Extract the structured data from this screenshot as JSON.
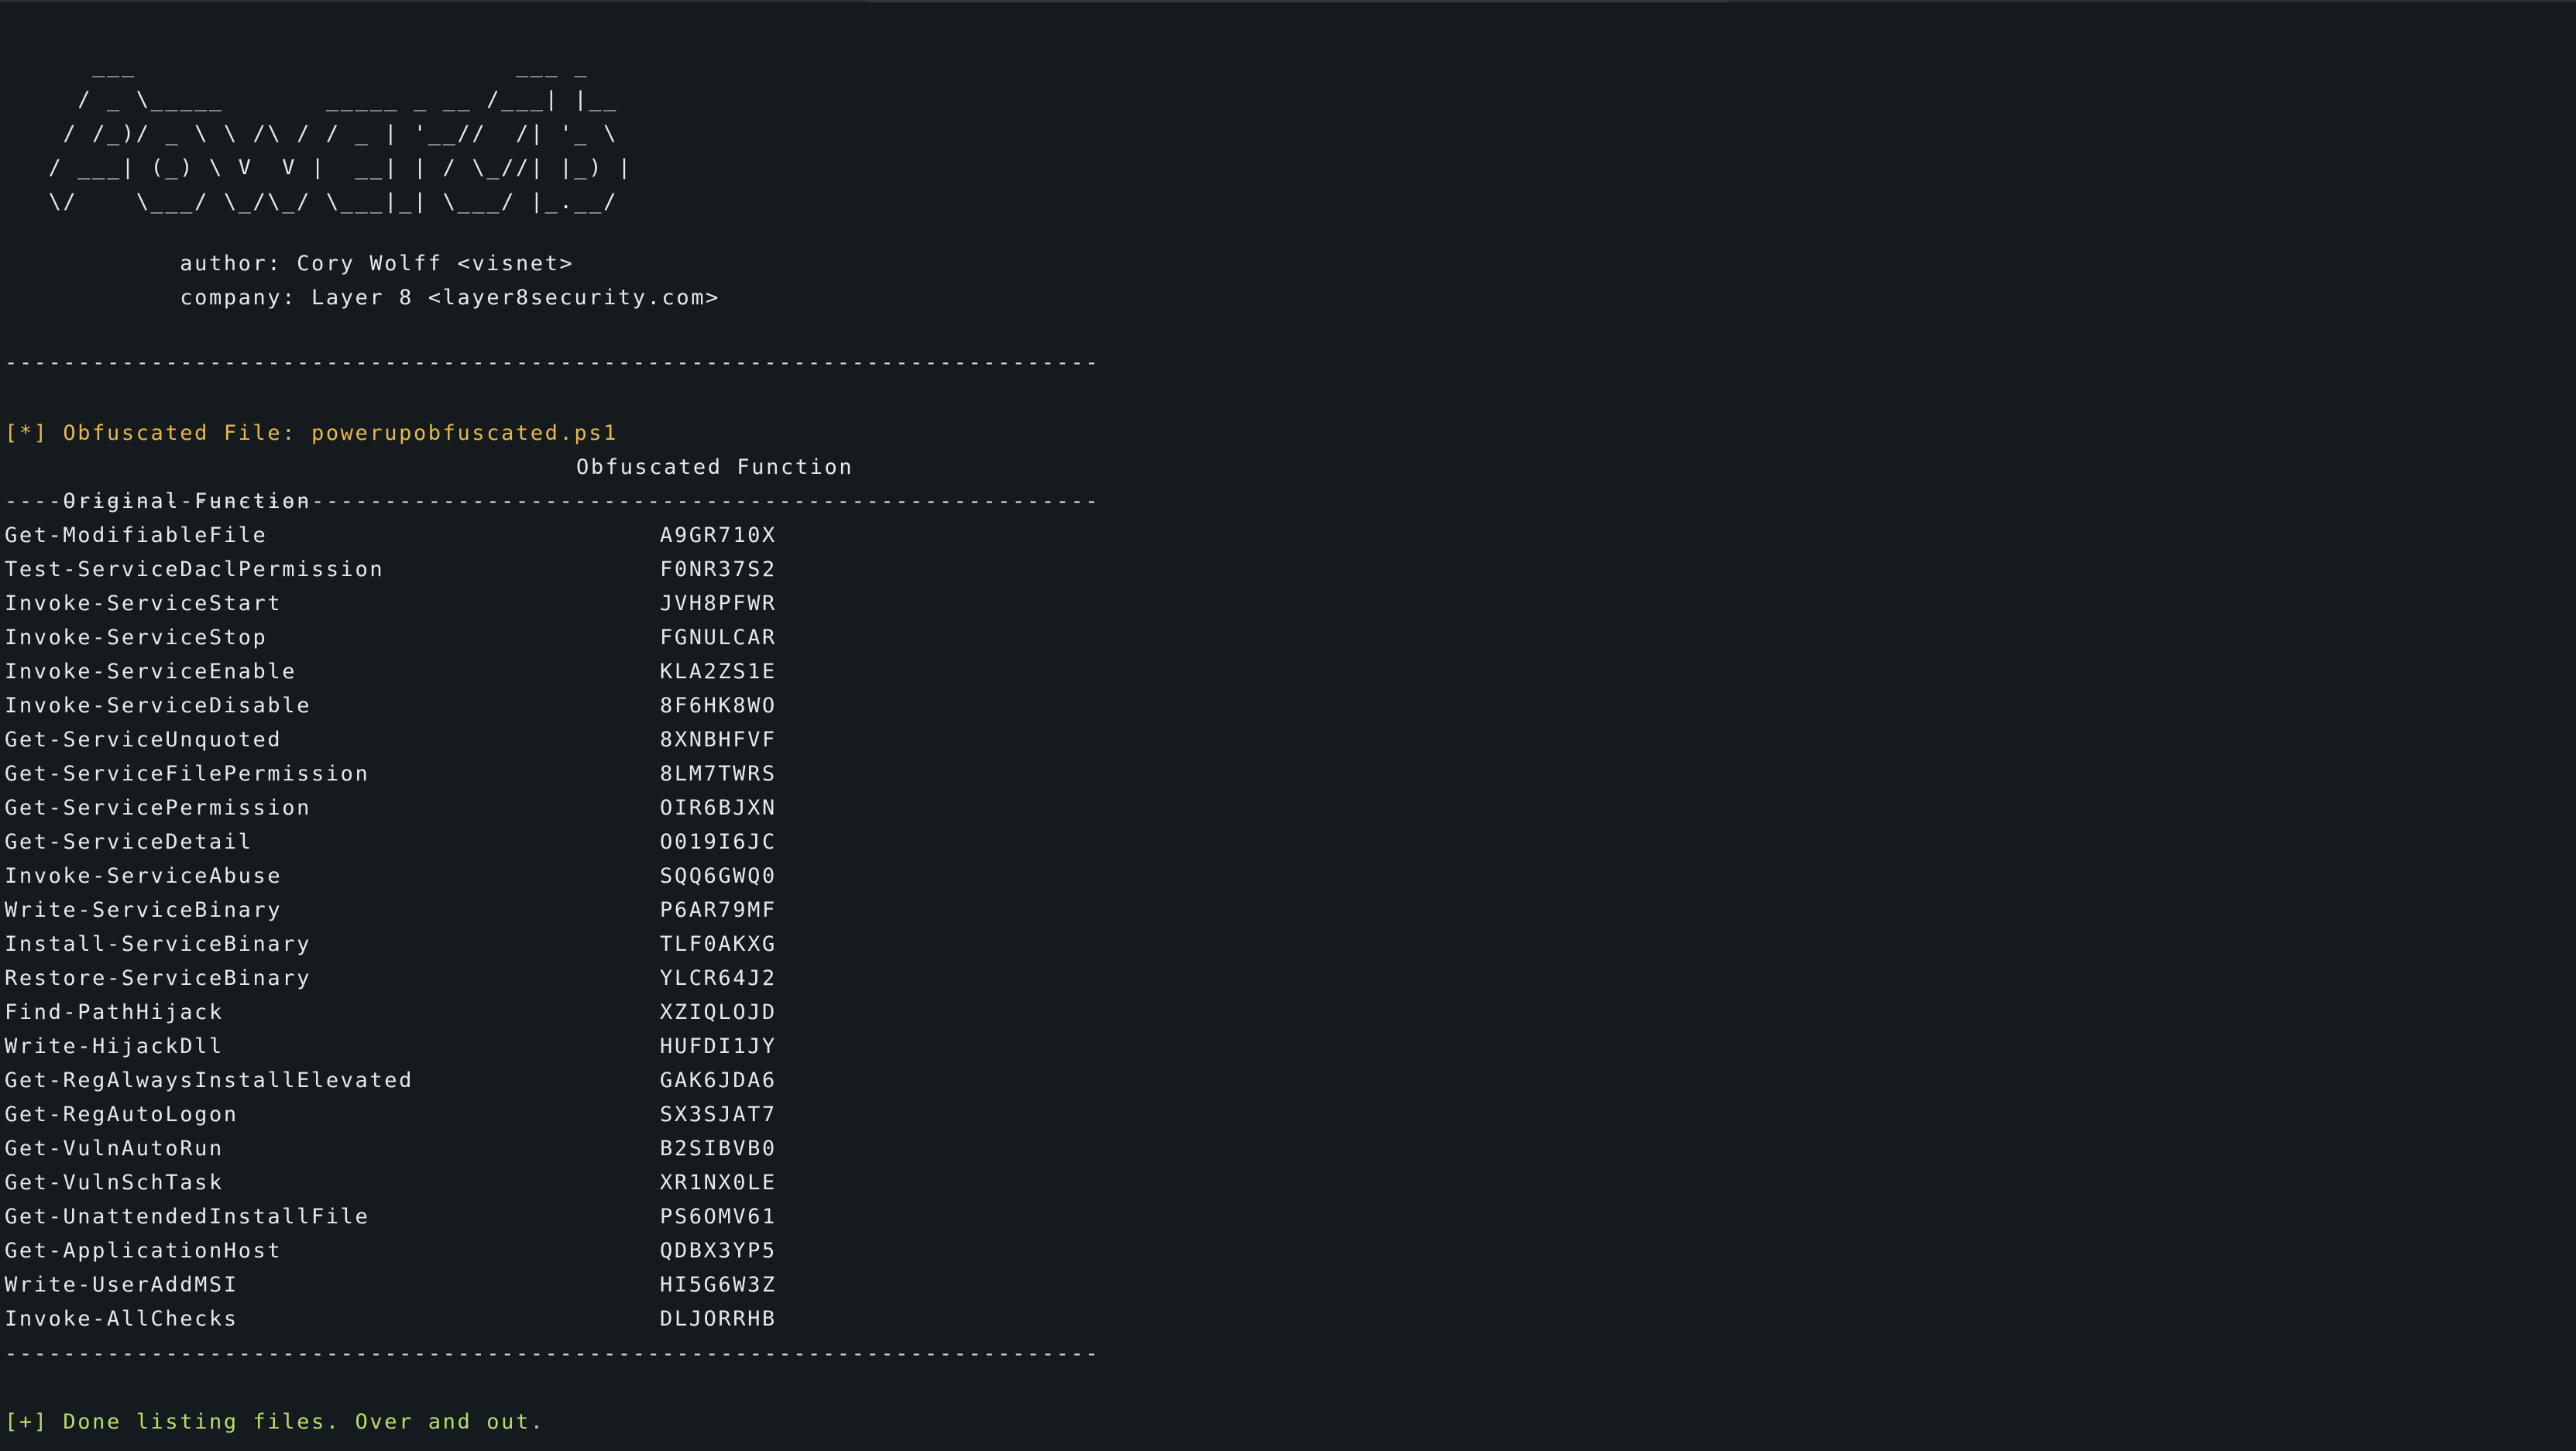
{
  "banner": {
    "ascii": [
      "      ___                          ___ _",
      "     / _ \\_____       _____ _ __ /___| |__",
      "    / /_)/ _ \\ \\ /\\ / / _ | '__//  /| '_ \\",
      "   / ___| (_) \\ V  V |  __| | / \\_//| |_) |",
      "   \\/    \\___/ \\_/\\_/ \\___|_| \\___/ |_.__/"
    ],
    "author_line": "            author: Cory Wolff <visnet>",
    "company_line": "            company: Layer 8 <layer8security.com>"
  },
  "rule": "---------------------------------------------------------------------------",
  "status_obfuscated": "[*] Obfuscated File: powerupobfuscated.ps1",
  "table": {
    "header_original": "Original Function",
    "header_obfuscated": "Obfuscated Function",
    "rows": [
      {
        "original": "Get-ModifiableFile",
        "obfuscated": "A9GR710X"
      },
      {
        "original": "Test-ServiceDaclPermission",
        "obfuscated": "F0NR37S2"
      },
      {
        "original": "Invoke-ServiceStart",
        "obfuscated": "JVH8PFWR"
      },
      {
        "original": "Invoke-ServiceStop",
        "obfuscated": "FGNULCAR"
      },
      {
        "original": "Invoke-ServiceEnable",
        "obfuscated": "KLA2ZS1E"
      },
      {
        "original": "Invoke-ServiceDisable",
        "obfuscated": "8F6HK8WO"
      },
      {
        "original": "Get-ServiceUnquoted",
        "obfuscated": "8XNBHFVF"
      },
      {
        "original": "Get-ServiceFilePermission",
        "obfuscated": "8LM7TWRS"
      },
      {
        "original": "Get-ServicePermission",
        "obfuscated": "OIR6BJXN"
      },
      {
        "original": "Get-ServiceDetail",
        "obfuscated": "O019I6JC"
      },
      {
        "original": "Invoke-ServiceAbuse",
        "obfuscated": "SQQ6GWQ0"
      },
      {
        "original": "Write-ServiceBinary",
        "obfuscated": "P6AR79MF"
      },
      {
        "original": "Install-ServiceBinary",
        "obfuscated": "TLF0AKXG"
      },
      {
        "original": "Restore-ServiceBinary",
        "obfuscated": "YLCR64J2"
      },
      {
        "original": "Find-PathHijack",
        "obfuscated": "XZIQLOJD"
      },
      {
        "original": "Write-HijackDll",
        "obfuscated": "HUFDI1JY"
      },
      {
        "original": "Get-RegAlwaysInstallElevated",
        "obfuscated": "GAK6JDA6"
      },
      {
        "original": "Get-RegAutoLogon",
        "obfuscated": "SX3SJAT7"
      },
      {
        "original": "Get-VulnAutoRun",
        "obfuscated": "B2SIBVB0"
      },
      {
        "original": "Get-VulnSchTask",
        "obfuscated": "XR1NX0LE"
      },
      {
        "original": "Get-UnattendedInstallFile",
        "obfuscated": "PS6OMV61"
      },
      {
        "original": "Get-ApplicationHost",
        "obfuscated": "QDBX3YP5"
      },
      {
        "original": "Write-UserAddMSI",
        "obfuscated": "HI5G6W3Z"
      },
      {
        "original": "Invoke-AllChecks",
        "obfuscated": "DLJORRHB"
      }
    ]
  },
  "status_done": "[+] Done listing files. Over and out.",
  "colors": {
    "background": "#141a1d",
    "text": "#e7eaec",
    "status_yellow": "#e7b94a",
    "status_green": "#b6df6a"
  }
}
